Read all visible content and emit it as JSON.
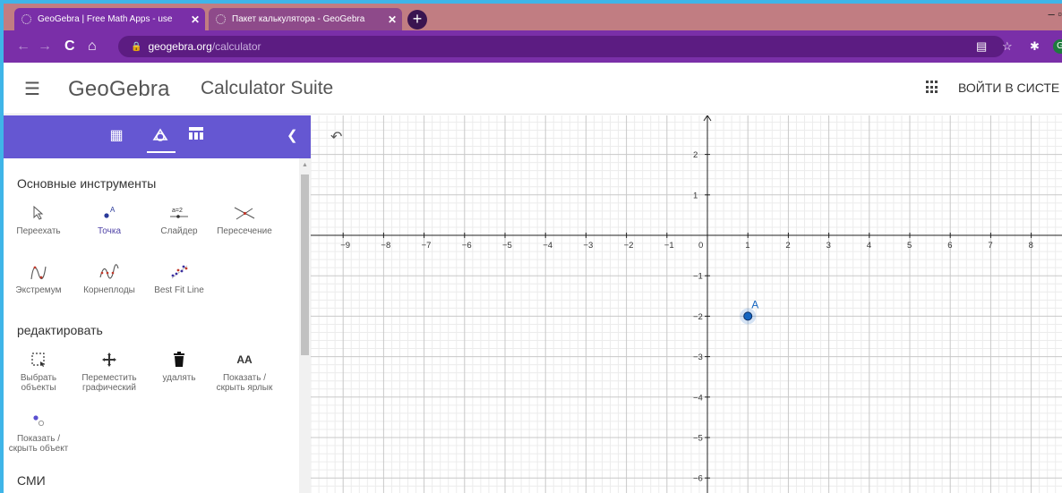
{
  "browser": {
    "tabs": [
      {
        "title": "GeoGebra | Free Math Apps - use",
        "close": "✕"
      },
      {
        "title": "Пакет калькулятора - GeoGebra",
        "close": "✕"
      }
    ],
    "new_tab": "+",
    "window_control": "– ▫",
    "url_domain": "geogebra.org",
    "url_path": "/calculator",
    "avatar_letter": "G"
  },
  "app": {
    "logo": "GeoGebra",
    "suite_name": "Calculator Suite",
    "signin": "ВОЙТИ В СИСТЕ"
  },
  "panel": {
    "sections": {
      "basic": "Основные инструменты",
      "edit": "редактировать",
      "media": "СМИ"
    },
    "tools_basic": [
      {
        "label": "Переехать",
        "icon": "move-arrow-icon"
      },
      {
        "label": "Точка",
        "icon": "point-icon"
      },
      {
        "label": "Слайдер",
        "icon": "slider-icon",
        "glyph": "a=2"
      },
      {
        "label": "Пересечение",
        "icon": "intersect-icon"
      },
      {
        "label": "Экстремум",
        "icon": "extremum-icon"
      },
      {
        "label": "Корнеплоды",
        "icon": "roots-icon"
      },
      {
        "label": "Best Fit Line",
        "icon": "best-fit-line-icon"
      }
    ],
    "tools_edit": [
      {
        "label": "Выбрать объекты",
        "icon": "select-objects-icon"
      },
      {
        "label": "Переместить графический",
        "icon": "move-graphics-icon"
      },
      {
        "label": "удалять",
        "icon": "delete-icon"
      },
      {
        "label": "Показать / скрыть ярлык",
        "icon": "show-hide-label-icon",
        "glyph": "AA"
      },
      {
        "label": "Показать / скрыть объект",
        "icon": "show-hide-object-icon"
      }
    ]
  },
  "graphics": {
    "x_ticks": [
      "−9",
      "−8",
      "−7",
      "−6",
      "−5",
      "−4",
      "−3",
      "−2",
      "−1",
      "0",
      "1",
      "2",
      "3",
      "4",
      "5",
      "6",
      "7",
      "8"
    ],
    "y_ticks": [
      "2",
      "1",
      "−1",
      "−2",
      "−3",
      "−4",
      "−5",
      "−6"
    ],
    "point": {
      "name": "A",
      "x": 1,
      "y": -2,
      "color": "#1565c0"
    },
    "x_range": [
      -9.8,
      8.8
    ],
    "y_range": [
      -6.3,
      2.8
    ]
  }
}
